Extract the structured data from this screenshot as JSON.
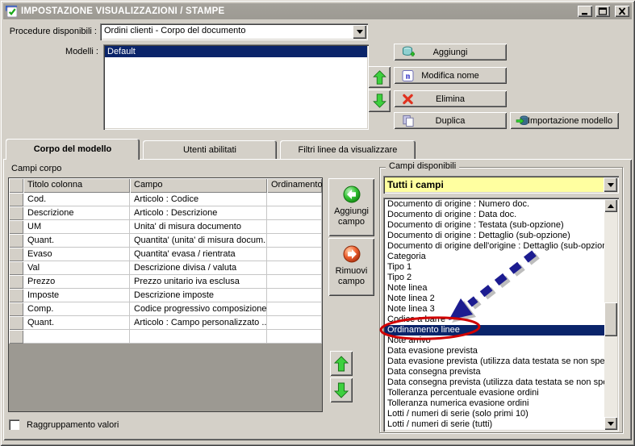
{
  "window": {
    "title": "IMPOSTAZIONE VISUALIZZAZIONI / STAMPE"
  },
  "header": {
    "procedures_label": "Procedure disponibili :",
    "procedures_value": "Ordini clienti - Corpo del documento",
    "models_label": "Modelli :",
    "models": [
      {
        "label": "Default",
        "selected": true
      }
    ],
    "buttons": {
      "add": "Aggiungi",
      "rename": "Modifica nome",
      "delete": "Elimina",
      "duplicate": "Duplica",
      "import": "Importazione modello"
    }
  },
  "tabs": [
    {
      "label": "Corpo del modello",
      "active": true
    },
    {
      "label": "Utenti abilitati",
      "active": false
    },
    {
      "label": "Filtri linee da visualizzare",
      "active": false
    }
  ],
  "body": {
    "campi_corpo_label": "Campi corpo",
    "table": {
      "columns": [
        "",
        "Titolo colonna",
        "Campo",
        "Ordinamento"
      ],
      "rows": [
        {
          "titolo": "Cod.",
          "campo": "Articolo : Codice",
          "ordinamento": ""
        },
        {
          "titolo": "Descrizione",
          "campo": "Articolo : Descrizione",
          "ordinamento": ""
        },
        {
          "titolo": "UM",
          "campo": "Unita' di misura documento",
          "ordinamento": ""
        },
        {
          "titolo": "Quant.",
          "campo": "Quantita' (unita' di misura docum...",
          "ordinamento": ""
        },
        {
          "titolo": "Evaso",
          "campo": "Quantita' evasa / rientrata",
          "ordinamento": ""
        },
        {
          "titolo": "Val",
          "campo": "Descrizione divisa / valuta",
          "ordinamento": ""
        },
        {
          "titolo": "Prezzo",
          "campo": "Prezzo unitario iva esclusa",
          "ordinamento": ""
        },
        {
          "titolo": "Imposte",
          "campo": "Descrizione imposte",
          "ordinamento": ""
        },
        {
          "titolo": "Comp.",
          "campo": "Codice progressivo composizione",
          "ordinamento": ""
        },
        {
          "titolo": "Quant.",
          "campo": "Articolo : Campo personalizzato ...",
          "ordinamento": ""
        },
        {
          "titolo": "",
          "campo": "",
          "ordinamento": ""
        }
      ]
    },
    "field_buttons": {
      "add": "Aggiungi campo",
      "remove": "Rimuovi campo"
    },
    "available": {
      "group_label": "Campi disponibili",
      "filter_value": "Tutti i campi",
      "items": [
        {
          "label": "Documento di origine : Numero doc.",
          "selected": false
        },
        {
          "label": "Documento di origine : Data doc.",
          "selected": false
        },
        {
          "label": "Documento di origine : Testata (sub-opzione)",
          "selected": false
        },
        {
          "label": "Documento di origine : Dettaglio (sub-opzione)",
          "selected": false
        },
        {
          "label": "Documento di origine dell'origine : Dettaglio (sub-opzione)",
          "selected": false
        },
        {
          "label": "Categoria",
          "selected": false
        },
        {
          "label": "Tipo 1",
          "selected": false
        },
        {
          "label": "Tipo 2",
          "selected": false
        },
        {
          "label": "Note linea",
          "selected": false
        },
        {
          "label": "Note linea 2",
          "selected": false
        },
        {
          "label": "Note linea 3",
          "selected": false
        },
        {
          "label": "Codice a barre",
          "selected": false
        },
        {
          "label": "Ordinamento linee",
          "selected": true
        },
        {
          "label": "Note arrivo",
          "selected": false
        },
        {
          "label": "Data evasione prevista",
          "selected": false
        },
        {
          "label": "Data evasione prevista (utilizza data testata se non specifi",
          "selected": false
        },
        {
          "label": "Data consegna prevista",
          "selected": false
        },
        {
          "label": "Data consegna prevista (utilizza data testata se non speci",
          "selected": false
        },
        {
          "label": "Tolleranza percentuale evasione ordini",
          "selected": false
        },
        {
          "label": "Tolleranza numerica evasione ordini",
          "selected": false
        },
        {
          "label": "Lotti / numeri di serie (solo primi 10)",
          "selected": false
        },
        {
          "label": "Lotti / numeri di serie (tutti)",
          "selected": false
        }
      ]
    },
    "grouping_checkbox_label": "Raggruppamento valori"
  },
  "colors": {
    "dialog": "#d4d0c8",
    "titlebar": "#9d9a93",
    "selection": "#0a246a",
    "highlight-yellow": "#ffffa0",
    "annotation-red": "#d10000",
    "annotation-blue": "#1c1c90",
    "green-accent": "#3ed03e"
  }
}
